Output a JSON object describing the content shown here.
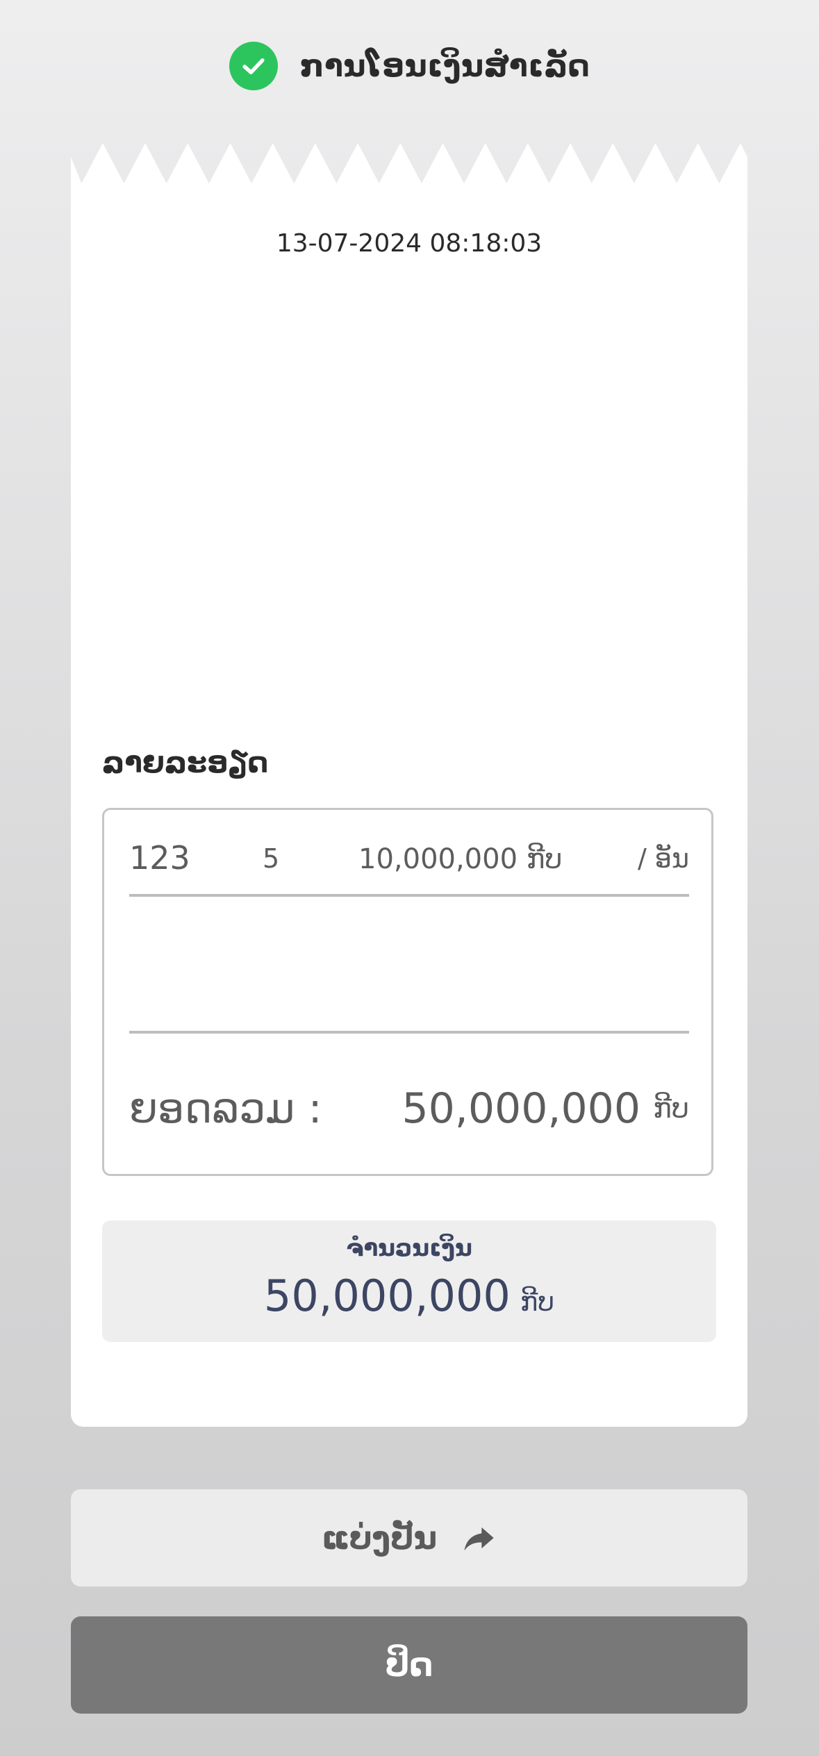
{
  "header": {
    "title": "ການໂອນເງິນສຳເລັດ",
    "status_icon": "check-circle-icon",
    "status_color": "#2cc55d"
  },
  "receipt": {
    "timestamp": "13-07-2024 08:18:03",
    "details_title": "ລາຍລະອຽດ",
    "items": [
      {
        "name": "123",
        "quantity": "5",
        "price": "10,000,000 ກີບ",
        "unit": "/ ອັນ"
      }
    ],
    "total": {
      "label": "ຍອດລວມ :",
      "value": "50,000,000",
      "currency": "ກີບ"
    },
    "amount": {
      "label": "ຈຳນວນເງິນ",
      "value": "50,000,000",
      "currency": "ກີບ"
    }
  },
  "actions": {
    "share_label": "ແບ່ງປັນ",
    "share_icon": "share-arrow-icon",
    "close_label": "ປິດ"
  }
}
